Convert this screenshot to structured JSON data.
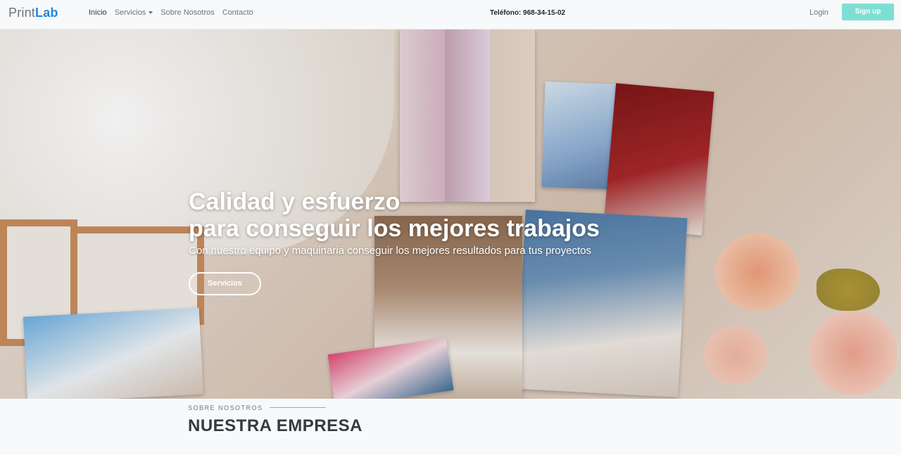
{
  "brand": {
    "part1": "Print",
    "part2": "Lab"
  },
  "nav": {
    "inicio": "Inicio",
    "servicios": "Servicios",
    "sobre": "Sobre Nosotros",
    "contacto": "Contacto"
  },
  "phone": "Teléfono: 968-34-15-02",
  "auth": {
    "login": "Login",
    "signup": "Sign up"
  },
  "hero": {
    "title_line1": "Calidad y esfuerzo",
    "title_line2": "para conseguir los mejores trabajos",
    "subtitle": "Con nuestro equipo y maquinaria conseguir los mejores resultados para tus proyectos",
    "button": "Servicios"
  },
  "about": {
    "eyebrow": "SOBRE NOSOTROS",
    "title": "NUESTRA EMPRESA"
  },
  "colors": {
    "brand_accent": "#1e88e5",
    "signup_bg": "#7fded4",
    "eyebrow_line": "#5fc3d6"
  }
}
